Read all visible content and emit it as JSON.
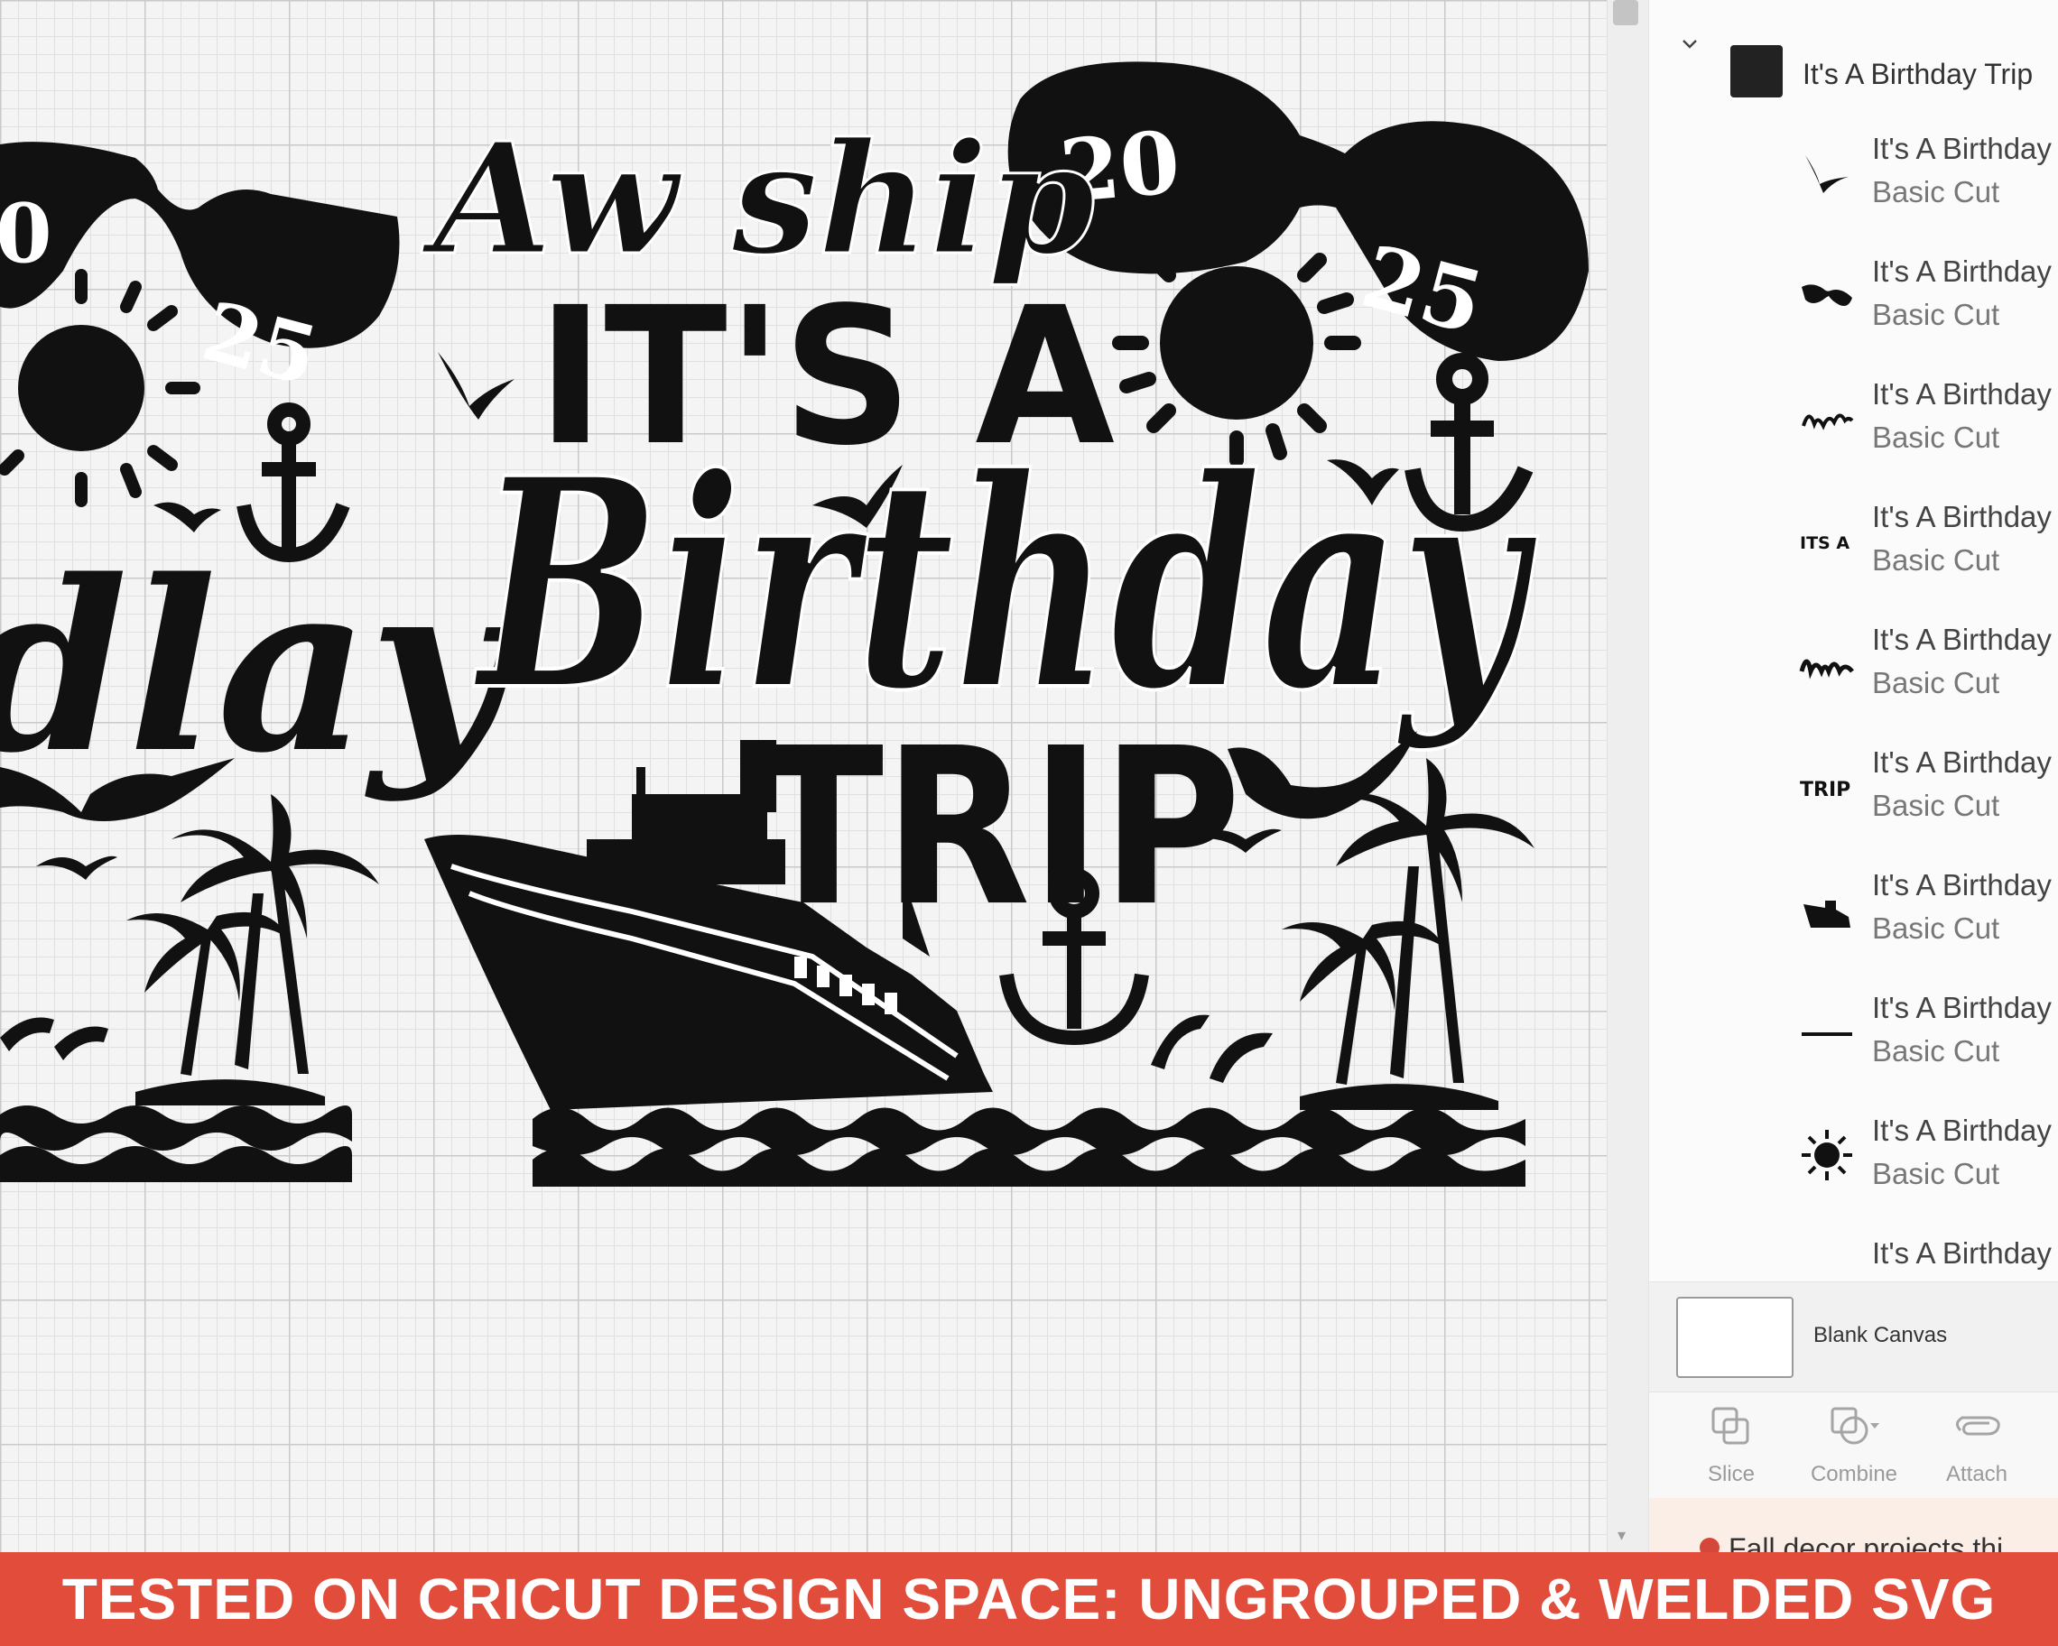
{
  "canvas": {
    "design": {
      "script_top": "Aw ship",
      "block_line": "IT'S A",
      "script_main": "Birthday",
      "block_bottom": "TRIP",
      "year_left": "20",
      "year_right": "25",
      "partial_script": "dlay",
      "partial_year_left": "0",
      "partial_year_right": "25"
    }
  },
  "layers_panel": {
    "group": {
      "title": "It's A Birthday Trip",
      "icon": "chevron-down-icon"
    },
    "layers": [
      {
        "name": "It's A Birthday",
        "operation": "Basic Cut",
        "thumb": "seagull"
      },
      {
        "name": "It's A Birthday",
        "operation": "Basic Cut",
        "thumb": "sunglasses"
      },
      {
        "name": "It's A Birthday",
        "operation": "Basic Cut",
        "thumb": "script-aw-ship"
      },
      {
        "name": "It's A Birthday",
        "operation": "Basic Cut",
        "thumb": "its-a-text",
        "thumb_text": "ITS A"
      },
      {
        "name": "It's A Birthday",
        "operation": "Basic Cut",
        "thumb": "birthday-script"
      },
      {
        "name": "It's A Birthday",
        "operation": "Basic Cut",
        "thumb": "trip-text",
        "thumb_text": "TRIP"
      },
      {
        "name": "It's A Birthday",
        "operation": "Basic Cut",
        "thumb": "ship"
      },
      {
        "name": "It's A Birthday",
        "operation": "Basic Cut",
        "thumb": "line"
      },
      {
        "name": "It's A Birthday",
        "operation": "Basic Cut",
        "thumb": "sun"
      },
      {
        "name": "It's A Birthday",
        "operation": "",
        "thumb": "partial"
      }
    ]
  },
  "blank_canvas": {
    "label": "Blank Canvas"
  },
  "tools": [
    {
      "label": "Slice",
      "icon": "slice-icon"
    },
    {
      "label": "Combine",
      "icon": "combine-icon"
    },
    {
      "label": "Attach",
      "icon": "attach-icon"
    }
  ],
  "promo": {
    "text": "Fall decor projects thi"
  },
  "banner": {
    "text": "TESTED ON CRICUT DESIGN SPACE: UNGROUPED & WELDED SVG"
  },
  "colors": {
    "banner_bg": "#e24c3a",
    "design_fill": "#111111"
  }
}
